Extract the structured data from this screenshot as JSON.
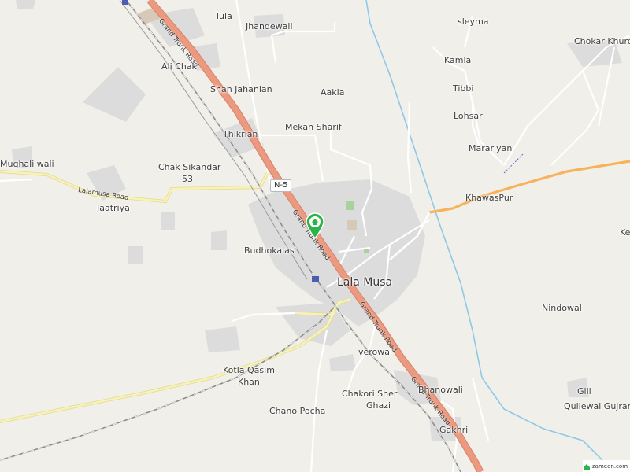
{
  "map": {
    "places": {
      "tula": "Tula",
      "jhandewali": "Jhandewali",
      "sleyma": "sleyma",
      "chokar_khurd": "Chokar Khurd",
      "ali_chak": "Ali Chak",
      "kamla": "Kamla",
      "shah_jahanian": "Shah Jahanian",
      "aakia": "Aakia",
      "tibbi": "Tibbi",
      "lohsar": "Lohsar",
      "mekan_sharif": "Mekan Sharif",
      "thikrian": "Thikrian",
      "marariyan": "Marariyan",
      "mughali_wali": "Mughali wali",
      "chak_sikandar": "Chak Sikandar",
      "chak_sikandar_num": "53",
      "khawaspur": "KhawasPur",
      "jaatriya": "Jaatriya",
      "ke": "Ke",
      "budhokalas": "Budhokalas",
      "lala_musa": "Lala Musa",
      "nindowal": "Nindowal",
      "verowal": "verowal",
      "kotla_qasim": "Kotla Qasim",
      "khan": "Khan",
      "bhanowali": "Bhanowali",
      "gill": "Gill",
      "qullewal_gujran": "Qullewal Gujran",
      "chakori_sher": "Chakori Sher",
      "ghazi": "Ghazi",
      "chano_pocha": "Chano Pocha",
      "gakhri": "Gakhri"
    },
    "roads": {
      "grand_trunk_road": "Grand Trunk Road",
      "lalamusa_road": "Lalamusa Road",
      "shield": "N-5"
    },
    "colors": {
      "land": "#f1efe9",
      "urban": "#dcdcdc",
      "highway": "#e9977b",
      "secondary_road": "#f3ee9b",
      "orange_road": "#f7b25c",
      "river": "#8dc9e8",
      "railway": "#888888",
      "pin": "#2bb44a"
    },
    "attribution": "zameen.com",
    "pin_icon": "home-icon"
  }
}
